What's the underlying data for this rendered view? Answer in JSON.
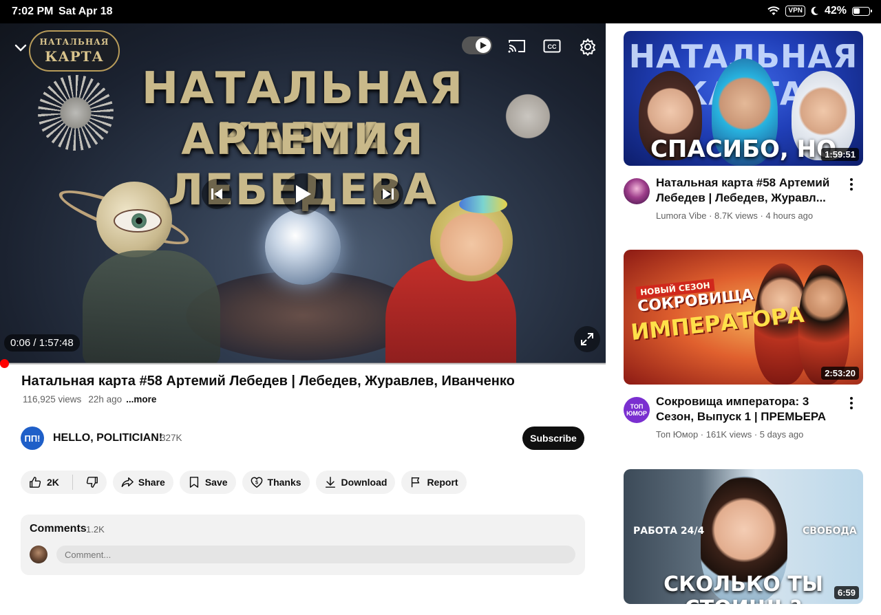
{
  "status_bar": {
    "time": "7:02 PM",
    "date": "Sat Apr 18",
    "vpn": "VPN",
    "battery": "42%"
  },
  "player": {
    "logo_line1": "НАТАЛЬНАЯ",
    "logo_line2": "КАРТА",
    "overlay_title_line1": "НАТАЛЬНАЯ КАРТА",
    "overlay_title_line2": "АРТЕМИЯ ЛЕБЕДЕВА",
    "time_display": "0:06 / 1:57:48",
    "progress": 0.001,
    "icons": [
      "chevron-down-icon",
      "autoplay-toggle",
      "cast-icon",
      "captions-icon",
      "settings-icon",
      "previous-icon",
      "play-icon",
      "next-icon",
      "fullscreen-icon"
    ]
  },
  "video": {
    "title": "Натальная карта #58 Артемий Лебедев | Лебедев, Журавлев, Иванченко",
    "views": "116,925 views",
    "age": "22h ago",
    "more": "...more"
  },
  "channel": {
    "avatar_text": "ПП!",
    "name": "HELLO, POLITICIAN!",
    "subs": "327K",
    "subscribe_label": "Subscribe"
  },
  "actions": {
    "likes": "2K",
    "share": "Share",
    "save": "Save",
    "thanks": "Thanks",
    "download": "Download",
    "report": "Report"
  },
  "comments": {
    "heading": "Comments",
    "count": "1.2K",
    "placeholder": "Comment..."
  },
  "recommendations": [
    {
      "thumb_text_top": "НАТАЛЬНАЯ КАРТА",
      "thumb_text_bottom": "СПАСИБО, НО НЕТ",
      "duration": "1:59:51",
      "title": "Натальная карта #58 Артемий Лебедев | Лебедев, Журавл...",
      "meta": "Lumora Vibe · 8.7K views · 4 hours ago"
    },
    {
      "thumb_badge": "НОВЫЙ СЕЗОН",
      "thumb_text_top": "СОКРОВИЩА",
      "thumb_text_bottom": "ИМПЕРАТОРА",
      "duration": "2:53:20",
      "avatar_text": "ТОП ЮМОР",
      "title": "Сокровища императора: 3 Сезон, Выпуск 1 | ПРЕМЬЕРА",
      "meta": "Топ Юмор · 161K views · 5 days ago"
    },
    {
      "thumb_text_left": "РАБОТА 24/4",
      "thumb_text_right": "СВОБОДА",
      "thumb_text_bottom": "СКОЛЬКО ТЫ СТОИШЬ?",
      "duration": "6:59"
    }
  ]
}
